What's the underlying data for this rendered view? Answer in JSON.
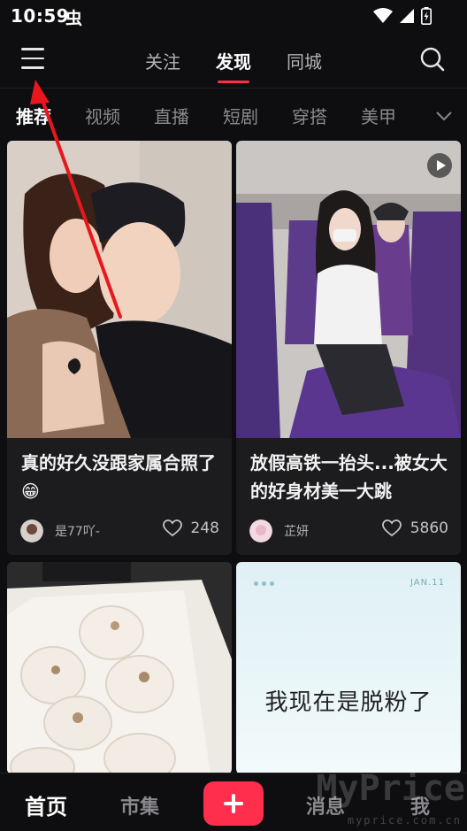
{
  "status_bar": {
    "time": "10:59",
    "notif_glyph": "虫"
  },
  "top_nav": {
    "tabs": [
      {
        "label": "关注",
        "active": false
      },
      {
        "label": "发现",
        "active": true
      },
      {
        "label": "同城",
        "active": false
      }
    ]
  },
  "categories": [
    "推荐",
    "视频",
    "直播",
    "短剧",
    "穿搭",
    "美甲"
  ],
  "feed": [
    {
      "title": "真的好久没跟家属合照了😁",
      "author": "是77吖-",
      "likes": "248"
    },
    {
      "title": "放假高铁一抬头...被女大的好身材美一大跳",
      "author": "芷妍",
      "likes": "5860"
    },
    {
      "title": "",
      "author": "",
      "likes": ""
    },
    {
      "title": "",
      "author": "",
      "likes": "",
      "image_text": "我现在是脱粉了",
      "date_tag": "JAN.11"
    }
  ],
  "bottom_nav": {
    "home": "首页",
    "market": "市集",
    "messages": "消息",
    "me": "我"
  },
  "watermark": {
    "brand": "MyPrice",
    "url": "myprice.com.cn"
  },
  "colors": {
    "accent": "#ff2e4d",
    "background": "#0e0e10",
    "card": "#1c1c1f"
  }
}
